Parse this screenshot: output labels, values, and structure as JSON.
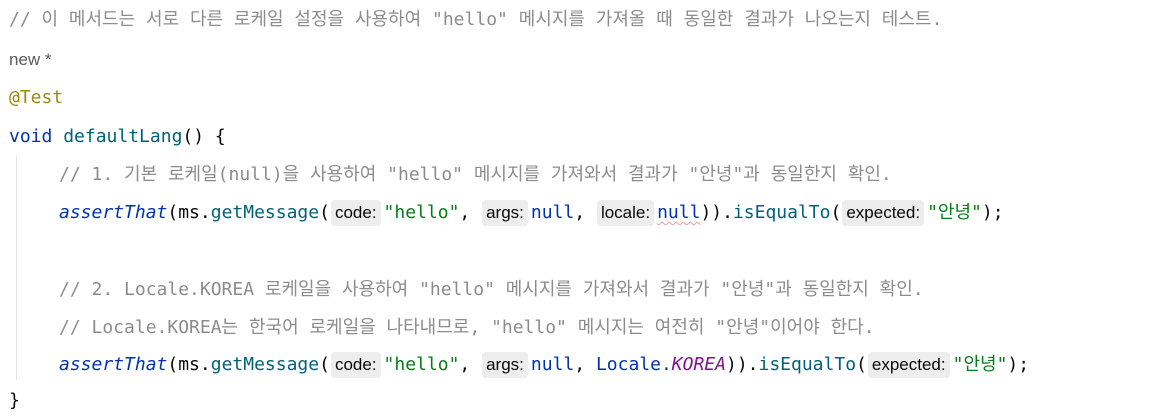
{
  "editor": {
    "line0_comment": "// 이 메서드는 서로 다른 로케일 설정을 사용하여 \"hello\" 메시지를 가져올 때 동일한 결과가 나오는지 테스트.",
    "author_hint": "new *",
    "annotation": "@Test",
    "method_decl": {
      "keyword": "void",
      "name": "defaultLang",
      "rest": "() {"
    },
    "comment_1": "// 1. 기본 로케일(null)을 사용하여 \"hello\" 메시지를 가져와서 결과가 \"안녕\"과 동일한지 확인.",
    "call_1": {
      "assert": "assertThat",
      "open": "(ms.",
      "get": "getMessage",
      "paren": "(",
      "hint_code": "code:",
      "str_hello": "\"hello\"",
      "comma1": ",",
      "hint_args": "args:",
      "null1": "null",
      "comma2": ",",
      "hint_locale": "locale:",
      "null2": "null",
      "close": ")).",
      "is_equal": "isEqualTo",
      "paren2": "(",
      "hint_expected": "expected:",
      "str_result": "\"안녕\"",
      "end": ");"
    },
    "comment_2": "// 2. Locale.KOREA 로케일을 사용하여 \"hello\" 메시지를 가져와서 결과가 \"안녕\"과 동일한지 확인.",
    "comment_3": "// Locale.KOREA는 한국어 로케일을 나타내므로, \"hello\" 메시지는 여전히 \"안녕\"이어야 한다.",
    "call_2": {
      "assert": "assertThat",
      "open": "(ms.",
      "get": "getMessage",
      "paren": "(",
      "hint_code": "code:",
      "str_hello": "\"hello\"",
      "comma1": ",",
      "hint_args": "args:",
      "null1": "null",
      "comma2": ", ",
      "locale_class": "Locale.",
      "locale_field": "KOREA",
      "close": ")).",
      "is_equal": "isEqualTo",
      "paren2": "(",
      "hint_expected": "expected:",
      "str_result": "\"안녕\"",
      "end": ");"
    },
    "closing_brace": "}"
  }
}
